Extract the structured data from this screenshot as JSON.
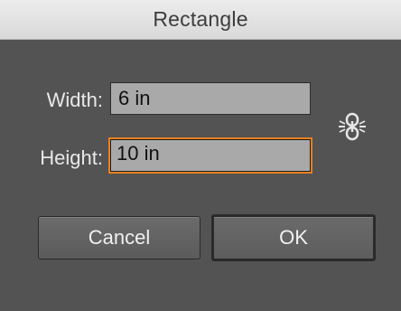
{
  "window": {
    "title": "Rectangle"
  },
  "form": {
    "width_label": "Width:",
    "width_value": "6 in",
    "height_label": "Height:",
    "height_value": "10 in",
    "link_icon": "constrain-proportions-link-icon"
  },
  "buttons": {
    "cancel_label": "Cancel",
    "ok_label": "OK"
  },
  "colors": {
    "focus_ring": "#e8801e",
    "dialog_bg": "#535353",
    "field_bg": "#a9a9a9"
  }
}
